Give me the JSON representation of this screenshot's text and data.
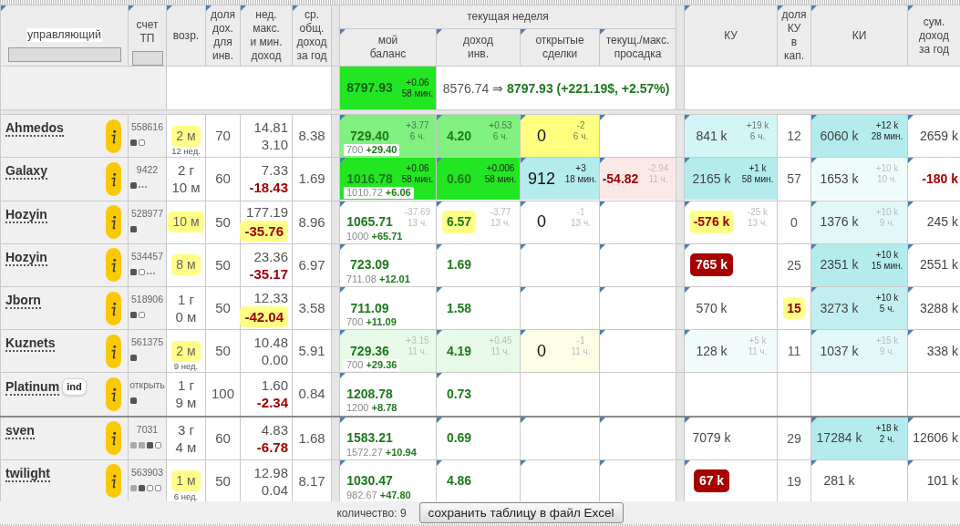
{
  "header": {
    "manager": "управляющий",
    "account": "счет\nТП",
    "age": "возр.",
    "share": "доля\nдох.\nдля\nинв.",
    "week_range": "нед.\nмакс.\nи мин.\nдоход",
    "avg_year": "ср.\nобщ.\nдоход\nза год",
    "current_week": "текущая неделя",
    "balance": "мой\nбаланс",
    "income": "доход\nинв.",
    "open_deals": "открытые\nсделки",
    "drawdown": "текущ./макс.\nпросадка",
    "ku": "КУ",
    "ku_share": "доля\nКУ\nв\nкап.",
    "ki": "КИ",
    "sum_year": "сум.\nдоход\nза год"
  },
  "summary": {
    "balance": {
      "value": "8797.93",
      "change": "+0.06",
      "since": "58 мин.",
      "faded": false,
      "muted": false,
      "color": "#22e622"
    },
    "result": "8576.74 ⇒ **8797.93 (+221.19$, +2.57%)**"
  },
  "rows": [
    {
      "name": "Ahmedos",
      "account": "558616",
      "markers": [
        {
          "kind": "filled"
        },
        {
          "kind": "empty"
        }
      ],
      "age": {
        "text": "2 м",
        "weeks": "12 нед.",
        "highlight": true
      },
      "share": "70",
      "week_max": "14.81",
      "week_min": {
        "text": "3.10",
        "loss": false,
        "highlight": false
      },
      "avg_year": "8.38",
      "balance": {
        "value": "729.40",
        "change": "+3.77",
        "since": "6 ч.",
        "faded": false,
        "muted": true,
        "base": "700 **+29.40**",
        "color": "#80f080"
      },
      "income": {
        "value": "4.20",
        "change": "+0.53",
        "since": "6 ч.",
        "faded": false,
        "muted": true,
        "highlight": false,
        "color": "#80f080"
      },
      "open_deals": {
        "value": "0",
        "change": "-2",
        "since": "6 ч.",
        "faded": false,
        "muted": true,
        "color": "#ffff80"
      },
      "ku": {
        "value": "841 k",
        "change": "+19 k",
        "since": "6 ч.",
        "faded": false,
        "muted": true,
        "kind": "plain",
        "loss": false,
        "color": "#d4f5f5"
      },
      "ku_share": {
        "value": "12",
        "highlight": false
      },
      "ki": {
        "value": "6060 k",
        "change": "+12 k",
        "since": "28 мин.",
        "faded": false,
        "muted": false,
        "color": "#b4ecee"
      },
      "sum_year": {
        "value": "2659 k",
        "loss": false
      },
      "corner_marks": true,
      "separator_above": false
    },
    {
      "name": "Galaxy",
      "account": "9422",
      "markers": [
        {
          "kind": "filled"
        },
        {
          "kind": "more"
        }
      ],
      "age": {
        "text": "2 г\n10 м",
        "highlight": false
      },
      "share": "60",
      "week_max": "7.33",
      "week_min": {
        "text": "-18.43",
        "loss": true,
        "highlight": false
      },
      "avg_year": "1.69",
      "balance": {
        "value": "1016.78",
        "change": "+0.06",
        "since": "58 мин.",
        "faded": false,
        "muted": false,
        "base": "1010.72 **+6.06**",
        "color": "#22e622"
      },
      "income": {
        "value": "0.60",
        "change": "+0.006",
        "since": "58 мин.",
        "faded": false,
        "muted": false,
        "highlight": false,
        "color": "#22e622"
      },
      "open_deals": {
        "value": "912",
        "change": "+3",
        "since": "18 мин.",
        "faded": false,
        "muted": false,
        "color": "#b4ecee"
      },
      "drawdown": {
        "value": "-54.82",
        "change": "-2.94",
        "since": "11 ч.",
        "faded": true,
        "muted": false,
        "color": "#fde8e8"
      },
      "ku": {
        "value": "2165 k",
        "change": "+1 k",
        "since": "58 мин.",
        "faded": false,
        "muted": false,
        "kind": "plain",
        "loss": false,
        "color": "#b4ecee"
      },
      "ku_share": {
        "value": "57",
        "highlight": false
      },
      "ki": {
        "value": "1653 k",
        "change": "+10 k",
        "since": "10 ч.",
        "faded": true,
        "muted": false,
        "color": "#effcfc"
      },
      "sum_year": {
        "value": "-180 k",
        "loss": true
      },
      "corner_marks": true,
      "separator_above": false
    },
    {
      "name": "Hozyin",
      "account": "528977",
      "markers": [
        {
          "kind": "filled"
        }
      ],
      "age": {
        "text": "10 м",
        "highlight": true
      },
      "share": "50",
      "week_max": "177.19",
      "week_min": {
        "text": "-35.76",
        "loss": true,
        "highlight": true
      },
      "avg_year": "8.96",
      "balance": {
        "value": "1065.71",
        "change": "-37.69",
        "since": "13 ч.",
        "faded": true,
        "muted": false,
        "base": "1000 **+65.71**"
      },
      "income": {
        "value": "6.57",
        "change": "-3.77",
        "since": "13 ч.",
        "faded": true,
        "muted": false,
        "highlight": true
      },
      "open_deals": {
        "value": "0",
        "change": "-1",
        "since": "13 ч.",
        "faded": true,
        "muted": false
      },
      "ku": {
        "value": "-576 k",
        "change": "-25 k",
        "since": "13 ч.",
        "faded": true,
        "muted": false,
        "kind": "warning",
        "loss": true
      },
      "ku_share": {
        "value": "0",
        "highlight": false
      },
      "ki": {
        "value": "1376 k",
        "change": "+10 k",
        "since": "9 ч.",
        "faded": true,
        "muted": false,
        "color": "#e2f7f7"
      },
      "sum_year": {
        "value": "245 k",
        "loss": false
      },
      "corner_marks": true,
      "separator_above": false
    },
    {
      "name": "Hozyin",
      "account": "534457",
      "markers": [
        {
          "kind": "filled"
        },
        {
          "kind": "empty"
        },
        {
          "kind": "more"
        }
      ],
      "age": {
        "text": "8 м",
        "highlight": true
      },
      "share": "50",
      "week_max": "23.36",
      "week_min": {
        "text": "-35.17",
        "loss": true,
        "highlight": false
      },
      "avg_year": "6.97",
      "balance": {
        "value": "723.09",
        "base": "711.08 **+12.01**"
      },
      "income": {
        "value": "1.69",
        "highlight": false
      },
      "ku": {
        "value": "765 k",
        "kind": "alert"
      },
      "ku_share": {
        "value": "25",
        "highlight": false
      },
      "ki": {
        "value": "2351 k",
        "change": "+10 k",
        "since": "15 мин.",
        "faded": false,
        "muted": false,
        "color": "#b4ecee"
      },
      "sum_year": {
        "value": "2551 k",
        "loss": false
      },
      "corner_marks": true,
      "separator_above": false
    },
    {
      "name": "Jborn",
      "account": "518906",
      "markers": [
        {
          "kind": "filled"
        },
        {
          "kind": "empty"
        }
      ],
      "age": {
        "text": "1 г\n0 м",
        "highlight": false
      },
      "share": "50",
      "week_max": "12.33",
      "week_min": {
        "text": "-42.04",
        "loss": true,
        "highlight": true
      },
      "avg_year": "3.58",
      "balance": {
        "value": "711.09",
        "base": "700 **+11.09**"
      },
      "income": {
        "value": "1.58",
        "highlight": false
      },
      "ku": {
        "value": "570 k",
        "kind": "plain",
        "loss": false
      },
      "ku_share": {
        "value": "15",
        "highlight": true
      },
      "ki": {
        "value": "3273 k",
        "change": "+10 k",
        "since": "5 ч.",
        "faded": false,
        "muted": false,
        "color": "#c2eef0"
      },
      "sum_year": {
        "value": "3288 k",
        "loss": false
      },
      "corner_marks": true,
      "separator_above": false
    },
    {
      "name": "Kuznets",
      "account": "561375",
      "markers": [
        {
          "kind": "filled"
        }
      ],
      "age": {
        "text": "2 м",
        "weeks": "9 нед.",
        "highlight": true
      },
      "share": "50",
      "week_max": "10.48",
      "week_min": {
        "text": "0.00",
        "loss": false,
        "highlight": false
      },
      "avg_year": "5.91",
      "balance": {
        "value": "729.36",
        "change": "+3.15",
        "since": "11 ч.",
        "faded": true,
        "muted": false,
        "base": "700 **+29.36**",
        "color": "#e8fae8"
      },
      "income": {
        "value": "4.19",
        "change": "+0.45",
        "since": "11 ч.",
        "faded": true,
        "muted": false,
        "highlight": false,
        "color": "#e8fae8"
      },
      "open_deals": {
        "value": "0",
        "change": "-1",
        "since": "11 ч.",
        "faded": true,
        "muted": false,
        "color": "#fdfde6"
      },
      "ku": {
        "value": "128 k",
        "change": "+5 k",
        "since": "11 ч.",
        "faded": true,
        "muted": false,
        "kind": "plain",
        "loss": false,
        "color": "#f2fcfc"
      },
      "ku_share": {
        "value": "11",
        "highlight": false
      },
      "ki": {
        "value": "1037 k",
        "change": "+15 k",
        "since": "9 ч.",
        "faded": true,
        "muted": false,
        "color": "#e2f7f7"
      },
      "sum_year": {
        "value": "338 k",
        "loss": false
      },
      "corner_marks": true,
      "separator_above": false
    },
    {
      "name": "Platinum",
      "tag": "ind",
      "account": "открыть",
      "markers": [
        {
          "kind": "filled"
        }
      ],
      "age": {
        "text": "1 г\n9 м",
        "highlight": false
      },
      "share": "100",
      "week_max": "1.60",
      "week_min": {
        "text": "-2.34",
        "loss": true,
        "highlight": false
      },
      "avg_year": "0.84",
      "balance": {
        "value": "1208.78",
        "base": "1200 **+8.78**"
      },
      "income": {
        "value": "0.73",
        "highlight": false
      },
      "corner_marks": false,
      "separator_above": false
    },
    {
      "name": "sven",
      "account": "7031",
      "markers": [
        {
          "kind": "faded"
        },
        {
          "kind": "faded"
        },
        {
          "kind": "filled"
        },
        {
          "kind": "empty"
        }
      ],
      "age": {
        "text": "3 г\n4 м",
        "highlight": false
      },
      "share": "60",
      "week_max": "4.83",
      "week_min": {
        "text": "-6.78",
        "loss": true,
        "highlight": false
      },
      "avg_year": "1.68",
      "balance": {
        "value": "1583.21",
        "base": "1572.27 **+10.94**"
      },
      "income": {
        "value": "0.69",
        "highlight": false
      },
      "ku": {
        "value": "7079 k",
        "kind": "plain",
        "loss": false
      },
      "ku_share": {
        "value": "29",
        "highlight": false
      },
      "ki": {
        "value": "17284 k",
        "change": "+18 k",
        "since": "2 ч.",
        "faded": false,
        "muted": false,
        "color": "#b4ecee"
      },
      "sum_year": {
        "value": "12606 k",
        "loss": false
      },
      "corner_marks": true,
      "separator_above": true
    },
    {
      "name": "twilight",
      "account": "563903",
      "markers": [
        {
          "kind": "faded"
        },
        {
          "kind": "filled"
        },
        {
          "kind": "empty"
        },
        {
          "kind": "empty"
        }
      ],
      "age": {
        "text": "1 м",
        "weeks": "6 нед.",
        "highlight": true
      },
      "share": "50",
      "week_max": "12.98",
      "week_min": {
        "text": "0.04",
        "loss": false,
        "highlight": false
      },
      "avg_year": "8.17",
      "balance": {
        "value": "1030.47",
        "base": "982.67 **+47.80**"
      },
      "income": {
        "value": "4.86",
        "highlight": false
      },
      "ku": {
        "value": "67 k",
        "kind": "alert"
      },
      "ku_share": {
        "value": "19",
        "highlight": false
      },
      "ki": {
        "value": "281 k"
      },
      "sum_year": {
        "value": "101 k",
        "loss": false
      },
      "corner_marks": true,
      "separator_above": false
    }
  ],
  "footer": {
    "count": "количество: 9",
    "export_button": "сохранить таблицу в файл Excel"
  }
}
